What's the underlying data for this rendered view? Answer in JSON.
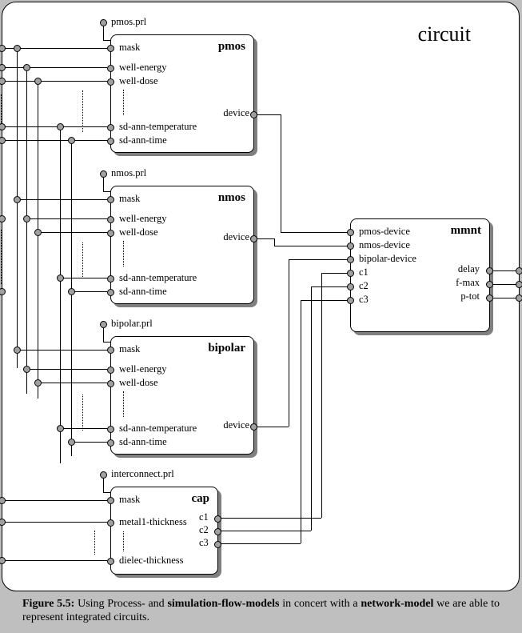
{
  "title": "circuit",
  "caption": {
    "fig": "Figure 5.5:",
    "before": "Using Process- and ",
    "kw1": "simulation-flow-models",
    "mid": " in concert with a ",
    "kw2": "network-model",
    "after": " we are able to represent integrated circuits."
  },
  "modules": {
    "pmos": {
      "title": "pmos",
      "prl": "pmos.prl",
      "inputs": [
        "mask",
        "well-energy",
        "well-dose",
        "sd-ann-temperature",
        "sd-ann-time"
      ],
      "outputs": [
        "device"
      ]
    },
    "nmos": {
      "title": "nmos",
      "prl": "nmos.prl",
      "inputs": [
        "mask",
        "well-energy",
        "well-dose",
        "sd-ann-temperature",
        "sd-ann-time"
      ],
      "outputs": [
        "device"
      ]
    },
    "bipolar": {
      "title": "bipolar",
      "prl": "bipolar.prl",
      "inputs": [
        "mask",
        "well-energy",
        "well-dose",
        "sd-ann-temperature",
        "sd-ann-time"
      ],
      "outputs": [
        "device"
      ]
    },
    "cap": {
      "title": "cap",
      "prl": "interconnect.prl",
      "inputs": [
        "mask",
        "metal1-thickness",
        "dielec-thickness"
      ],
      "outputs": [
        "c1",
        "c2",
        "c3"
      ]
    },
    "mmnt": {
      "title": "mmnt",
      "inputs": [
        "pmos-device",
        "nmos-device",
        "bipolar-device",
        "c1",
        "c2",
        "c3"
      ],
      "outputs": [
        "delay",
        "f-max",
        "p-tot"
      ]
    }
  }
}
